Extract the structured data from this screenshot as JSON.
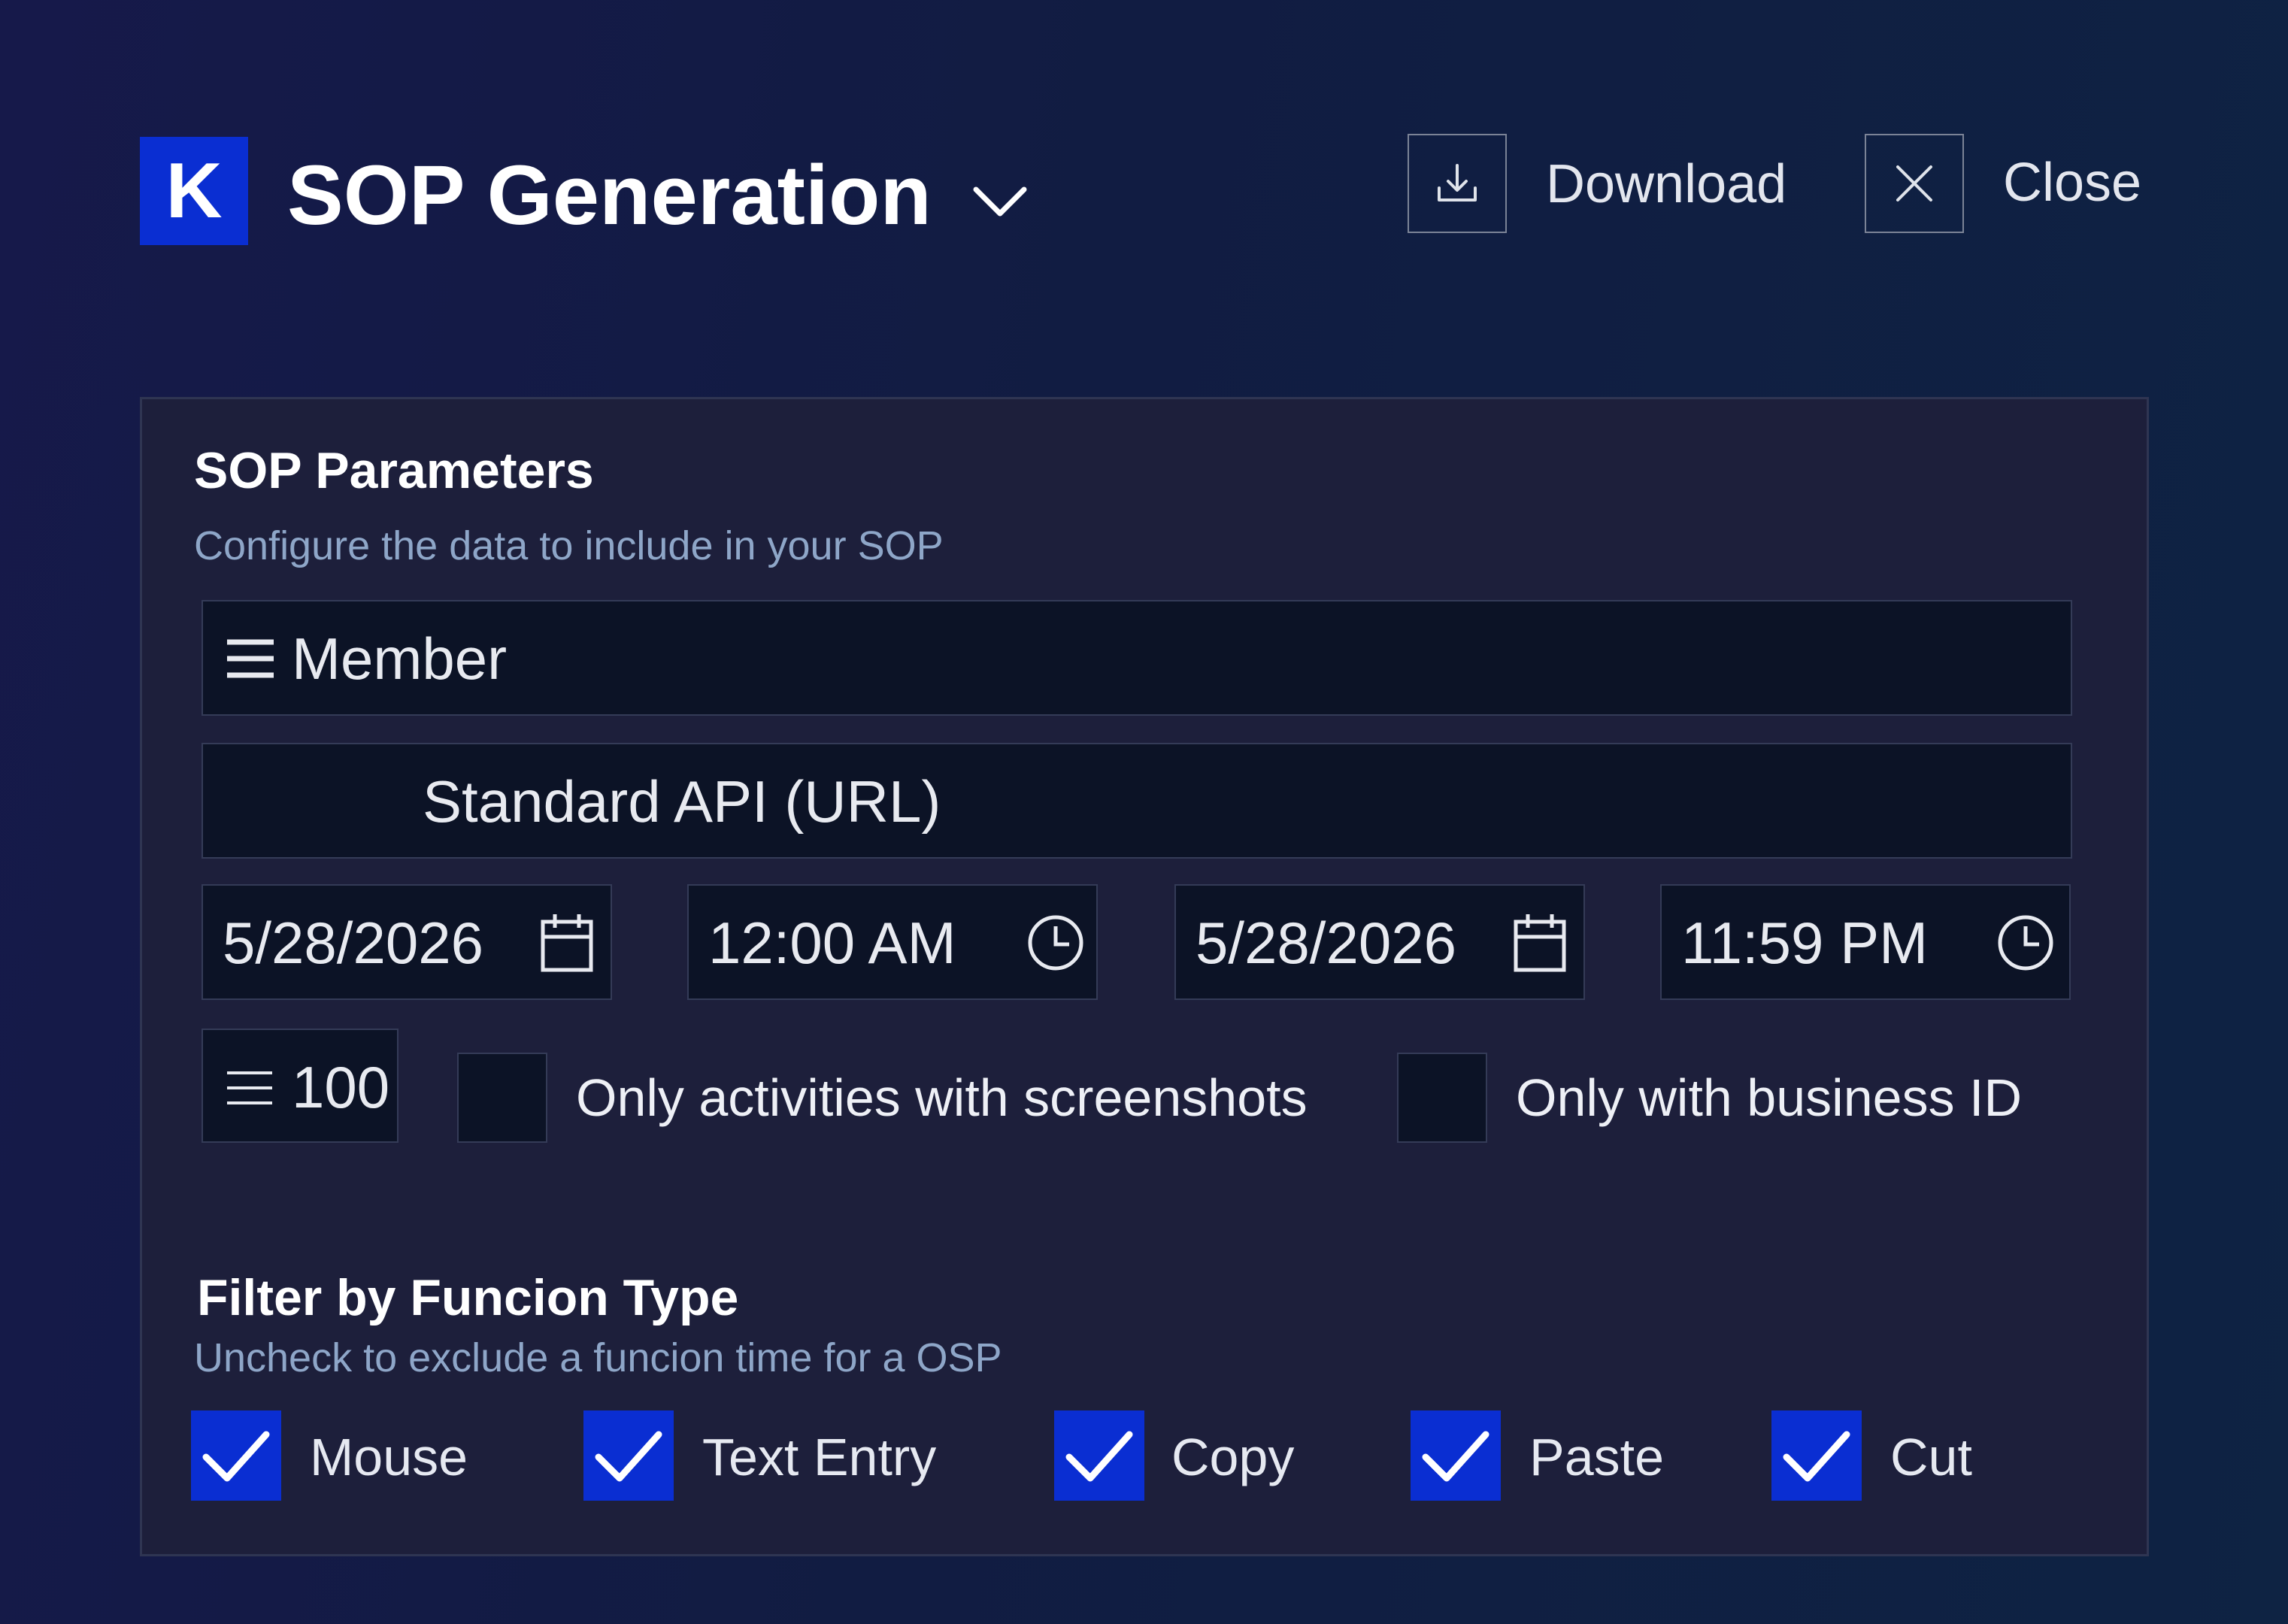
{
  "header": {
    "logo_letter": "K",
    "title": "SOP Generation",
    "download_label": "Download",
    "close_label": "Close"
  },
  "panel": {
    "title": "SOP Parameters",
    "subtitle": "Configure the data to include in your SOP",
    "member_select": "Member",
    "source_select": "Standard API (URL)",
    "start_date": "5/28/2026",
    "start_time": "12:00 AM",
    "end_date": "5/28/2026",
    "end_time": "11:59 PM",
    "limit_value": "100",
    "options": [
      {
        "label": "Only activities with screenshots",
        "checked": false
      },
      {
        "label": "Only with business ID",
        "checked": false
      }
    ],
    "filter_title": "Filter by Funcion Type",
    "filter_subtitle": "Uncheck to exclude a funcion time for a OSP",
    "function_types": [
      {
        "label": "Mouse",
        "checked": true
      },
      {
        "label": "Text Entry",
        "checked": true
      },
      {
        "label": "Copy",
        "checked": true
      },
      {
        "label": "Paste",
        "checked": true
      },
      {
        "label": "Cut",
        "checked": true
      }
    ]
  },
  "colors": {
    "accent": "#0a2ed2",
    "panel_bg": "#1d1f3b",
    "field_bg": "#0c1326",
    "subtitle": "#8ea6c8"
  },
  "icons": [
    "menu-icon",
    "calendar-icon",
    "clock-icon",
    "download-icon",
    "close-icon",
    "chevron-down-icon",
    "checkmark-icon"
  ]
}
